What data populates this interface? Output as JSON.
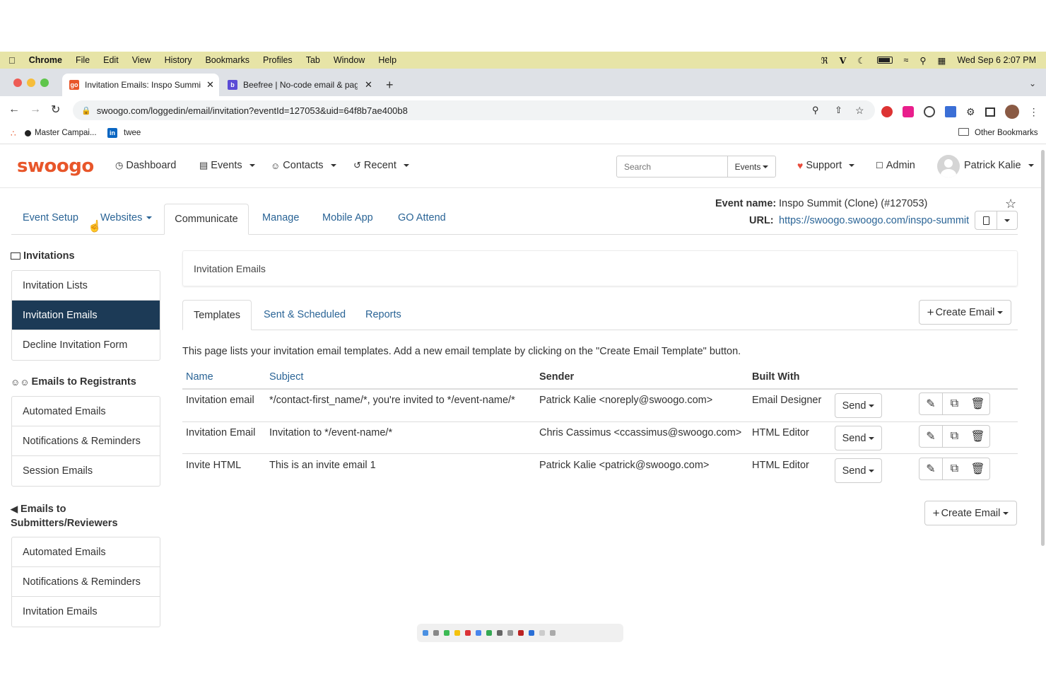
{
  "mac_menu": {
    "app": "Chrome",
    "items": [
      "File",
      "Edit",
      "View",
      "History",
      "Bookmarks",
      "Profiles",
      "Tab",
      "Window",
      "Help"
    ],
    "datetime": "Wed Sep 6  2:07 PM"
  },
  "browser": {
    "tabs": [
      {
        "title": "Invitation Emails: Inspo Summi",
        "active": true
      },
      {
        "title": "Beefree | No-code email & pag",
        "active": false
      }
    ],
    "url": "swoogo.com/loggedin/email/invitation?eventId=127053&uid=64f8b7ae400b8",
    "bookmarks": [
      "Master Campai...",
      "twee"
    ],
    "other_bookmarks": "Other Bookmarks"
  },
  "app": {
    "logo": "swoogo",
    "nav": {
      "dashboard": "Dashboard",
      "events": "Events",
      "contacts": "Contacts",
      "recent": "Recent"
    },
    "search_placeholder": "Search",
    "search_scope": "Events",
    "support": "Support",
    "admin": "Admin",
    "user": "Patrick Kalie"
  },
  "subnav": {
    "tabs": [
      "Event Setup",
      "Websites",
      "Communicate",
      "Manage",
      "Mobile App",
      "GO Attend"
    ],
    "active": "Communicate"
  },
  "event": {
    "name_label": "Event name:",
    "name": "Inspo Summit (Clone) (#127053)",
    "url_label": "URL:",
    "url": "https://swoogo.swoogo.com/inspo-summit"
  },
  "sidebar": {
    "invitations_heading": "Invitations",
    "invitations": [
      "Invitation Lists",
      "Invitation Emails",
      "Decline Invitation Form"
    ],
    "registrants_heading": "Emails to Registrants",
    "registrants": [
      "Automated Emails",
      "Notifications & Reminders",
      "Session Emails"
    ],
    "submitters_heading": "Emails to Submitters/Reviewers",
    "submitters": [
      "Automated Emails",
      "Notifications & Reminders",
      "Invitation Emails"
    ]
  },
  "main": {
    "panel_title": "Invitation Emails",
    "tabs": [
      "Templates",
      "Sent & Scheduled",
      "Reports"
    ],
    "create_email": "Create Email",
    "description": "This page lists your invitation email templates. Add a new email template by clicking on the \"Create Email Template\" button.",
    "columns": [
      "Name",
      "Subject",
      "Sender",
      "Built With"
    ],
    "send_label": "Send",
    "rows": [
      {
        "name": "Invitation email",
        "subject": "*/contact-first_name/*, you're invited to */event-name/*",
        "sender": "Patrick Kalie <noreply@swoogo.com>",
        "built_with": "Email Designer"
      },
      {
        "name": "Invitation Email",
        "subject": "Invitation to */event-name/*",
        "sender": "Chris Cassimus <ccassimus@swoogo.com>",
        "built_with": "HTML Editor"
      },
      {
        "name": "Invite HTML",
        "subject": "This is an invite email 1",
        "sender": "Patrick Kalie <patrick@swoogo.com>",
        "built_with": "HTML Editor"
      }
    ]
  },
  "colors": {
    "accent": "#e8562a",
    "link": "#2a6496",
    "sidebar_active": "#1c3a56",
    "macbar": "#e7e4a7"
  }
}
